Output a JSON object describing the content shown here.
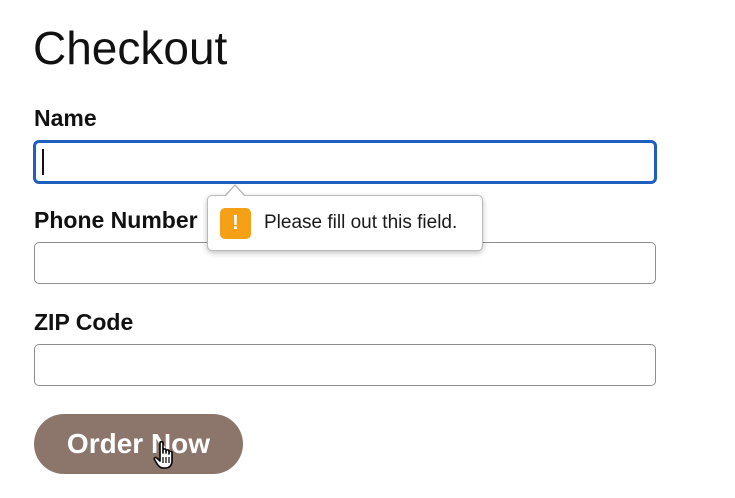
{
  "page": {
    "title": "Checkout"
  },
  "form": {
    "name": {
      "label": "Name",
      "value": "",
      "placeholder": ""
    },
    "phone": {
      "label": "Phone Number",
      "value": "",
      "placeholder": ""
    },
    "zip": {
      "label": "ZIP Code",
      "value": "",
      "placeholder": ""
    }
  },
  "validation": {
    "message": "Please fill out this field.",
    "icon": "warning-icon",
    "icon_glyph": "!",
    "icon_color": "#f5a017"
  },
  "submit": {
    "label": "Order Now",
    "color": "#8c766b"
  },
  "cursor": {
    "icon": "hand-pointer-icon"
  }
}
